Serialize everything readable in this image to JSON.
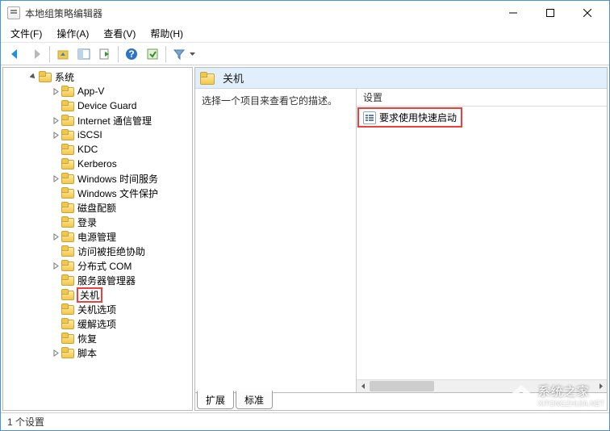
{
  "title": "本地组策略编辑器",
  "menus": {
    "file": "文件(F)",
    "action": "操作(A)",
    "view": "查看(V)",
    "help": "帮助(H)"
  },
  "tree": {
    "root": {
      "label": "系统",
      "children": [
        {
          "label": "App-V",
          "expandable": true
        },
        {
          "label": "Device Guard"
        },
        {
          "label": "Internet 通信管理",
          "expandable": true
        },
        {
          "label": "iSCSI",
          "expandable": true
        },
        {
          "label": "KDC"
        },
        {
          "label": "Kerberos"
        },
        {
          "label": "Windows 时间服务",
          "expandable": true
        },
        {
          "label": "Windows 文件保护"
        },
        {
          "label": "磁盘配额"
        },
        {
          "label": "登录"
        },
        {
          "label": "电源管理",
          "expandable": true
        },
        {
          "label": "访问被拒绝协助"
        },
        {
          "label": "分布式 COM",
          "expandable": true
        },
        {
          "label": "服务器管理器"
        },
        {
          "label": "关机",
          "selected": true
        },
        {
          "label": "关机选项"
        },
        {
          "label": "缓解选项"
        },
        {
          "label": "恢复"
        },
        {
          "label": "脚本",
          "expandable": true
        }
      ]
    }
  },
  "header": {
    "label": "关机"
  },
  "desc_prompt": "选择一个项目来查看它的描述。",
  "list": {
    "column": "设置",
    "items": [
      {
        "label": "要求使用快速启动"
      }
    ]
  },
  "tabs": {
    "extended": "扩展",
    "standard": "标准"
  },
  "status": "1 个设置",
  "watermark": {
    "text": "系统之家",
    "sub": "XITONGZHIJIA.NET"
  }
}
